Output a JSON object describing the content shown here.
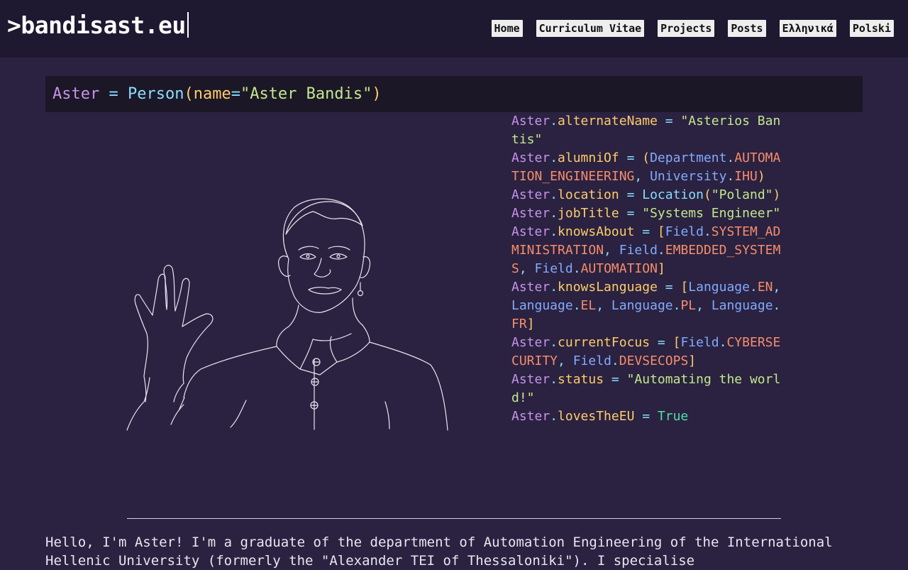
{
  "header": {
    "logo": ">bandisast.eu",
    "nav": [
      "Home",
      "Curriculum Vitae",
      "Projects",
      "Posts",
      "Ελληνικά",
      "Polski"
    ]
  },
  "code_head": {
    "var": "Aster",
    "eq": " = ",
    "cls": "Person",
    "open": "(",
    "arg": "name",
    "argeq": "=",
    "str": "\"Aster Bandis\"",
    "close": ")"
  },
  "properties": [
    {
      "obj": "Aster",
      "prop": "alternateName",
      "value_str": "\"Asterios Bantis\""
    },
    {
      "obj": "Aster",
      "prop": "alumniOf",
      "open": "(",
      "parts": [
        [
          "Department",
          "AUTOMATION_ENGINEERING"
        ],
        [
          "University",
          "IHU"
        ]
      ],
      "close": ")"
    },
    {
      "obj": "Aster",
      "prop": "location",
      "cls": "Location",
      "arg": "\"Poland\""
    },
    {
      "obj": "Aster",
      "prop": "jobTitle",
      "value_str": "\"Systems Engineer\""
    },
    {
      "obj": "Aster",
      "prop": "knowsAbout",
      "open": "[",
      "parts": [
        [
          "Field",
          "SYSTEM_ADMINISTRATION"
        ],
        [
          "Field",
          "EMBEDDED_SYSTEMS"
        ],
        [
          "Field",
          "AUTOMATION"
        ]
      ],
      "close": "]"
    },
    {
      "obj": "Aster",
      "prop": "knowsLanguage",
      "open": "[",
      "parts": [
        [
          "Language",
          "EN"
        ],
        [
          "Language",
          "EL"
        ],
        [
          "Language",
          "PL"
        ],
        [
          "Language",
          "FR"
        ]
      ],
      "close": "]"
    },
    {
      "obj": "Aster",
      "prop": "currentFocus",
      "open": "[",
      "parts": [
        [
          "Field",
          "CYBERSECURITY"
        ],
        [
          "Field",
          "DEVSECOPS"
        ]
      ],
      "close": "]"
    },
    {
      "obj": "Aster",
      "prop": "status",
      "value_str": "\"Automating the world!\""
    },
    {
      "obj": "Aster",
      "prop": "lovesTheEU",
      "value_bool": "True"
    }
  ],
  "intro": "Hello, I'm Aster! I'm a graduate of the department of Automation Engineering of the International Hellenic University (formerly the \"Alexander TEI of Thessaloniki\"). I specialise",
  "colors": {
    "background": "#2a2240",
    "header": "#1e1830",
    "code_head_bg": "#1c1727",
    "var": "#c792ea",
    "property": "#ffcb6b",
    "string": "#c3e88d",
    "class": "#82aaff",
    "constant": "#f78c6c",
    "boolean": "#4ee0a8"
  }
}
